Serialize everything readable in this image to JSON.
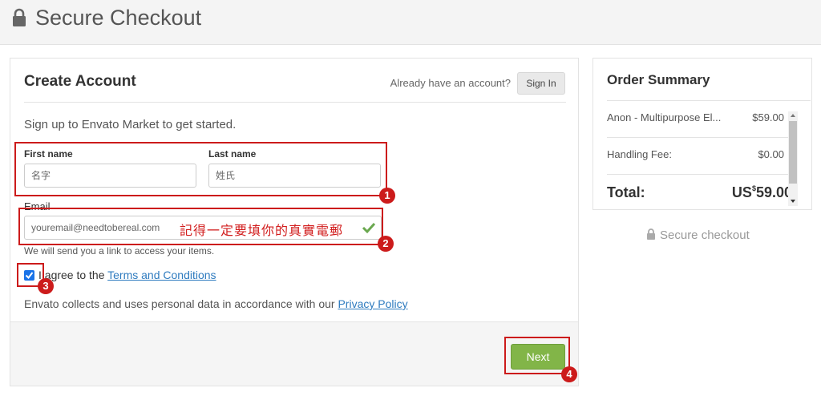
{
  "header": {
    "title": "Secure Checkout"
  },
  "form": {
    "title": "Create Account",
    "signin_prompt": "Already have an account?",
    "signin_button": "Sign In",
    "subtitle": "Sign up to Envato Market to get started.",
    "first_name_label": "First name",
    "first_name_value": "名字",
    "last_name_label": "Last name",
    "last_name_value": "姓氏",
    "email_label": "Email",
    "email_value": "youremail@needtobereal.com",
    "email_help": "We will send you a link to access your items.",
    "agree_prefix": "I agree to the ",
    "terms_link": "Terms and Conditions",
    "privacy_prefix": "Envato collects and uses personal data in accordance with our ",
    "privacy_link": "Privacy Policy",
    "next_button": "Next"
  },
  "annotations": {
    "email_note": "記得一定要填你的真實電郵",
    "n1": "1",
    "n2": "2",
    "n3": "3",
    "n4": "4",
    "color": "#cc1b1b"
  },
  "summary": {
    "title": "Order Summary",
    "rows": [
      {
        "label": "Anon - Multipurpose El...",
        "value": "$59.00"
      },
      {
        "label": "Handling Fee:",
        "value": "$0.00"
      }
    ],
    "total_label": "Total:",
    "total_currency": "US",
    "total_symbol": "$",
    "total_amount": "59.00"
  },
  "secure_note": "Secure checkout",
  "colors": {
    "next_button": "#82b548",
    "link": "#2e7bbf",
    "checkbox": "#1a73e8",
    "email_valid": "#6aa84f"
  }
}
